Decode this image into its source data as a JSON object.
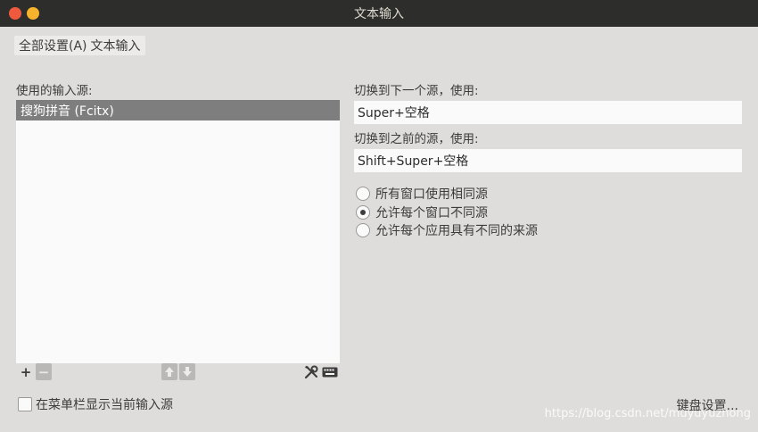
{
  "window": {
    "title": "文本输入"
  },
  "breadcrumb": {
    "all_settings": "全部设置(A)",
    "current": "文本输入"
  },
  "input_sources": {
    "label": "使用的输入源:",
    "items": [
      "搜狗拼音 (Fcitx)"
    ]
  },
  "shortcuts": {
    "next_label": "切换到下一个源，使用:",
    "next_value": "Super+空格",
    "prev_label": "切换到之前的源，使用:",
    "prev_value": "Shift+Super+空格"
  },
  "source_mode": {
    "options": [
      "所有窗口使用相同源",
      "允许每个窗口不同源",
      "允许每个应用具有不同的来源"
    ],
    "selected_index": 1
  },
  "footer": {
    "show_in_menubar_label": "在菜单栏显示当前输入源",
    "show_in_menubar_checked": false,
    "keyboard_settings_label": "键盘设置..."
  },
  "toolbar": {
    "add_icon": "+",
    "remove_icon": "−",
    "up_icon": "🡅",
    "down_icon": "🡇"
  },
  "watermark": "https://blog.csdn.net/muyuyuzhong"
}
